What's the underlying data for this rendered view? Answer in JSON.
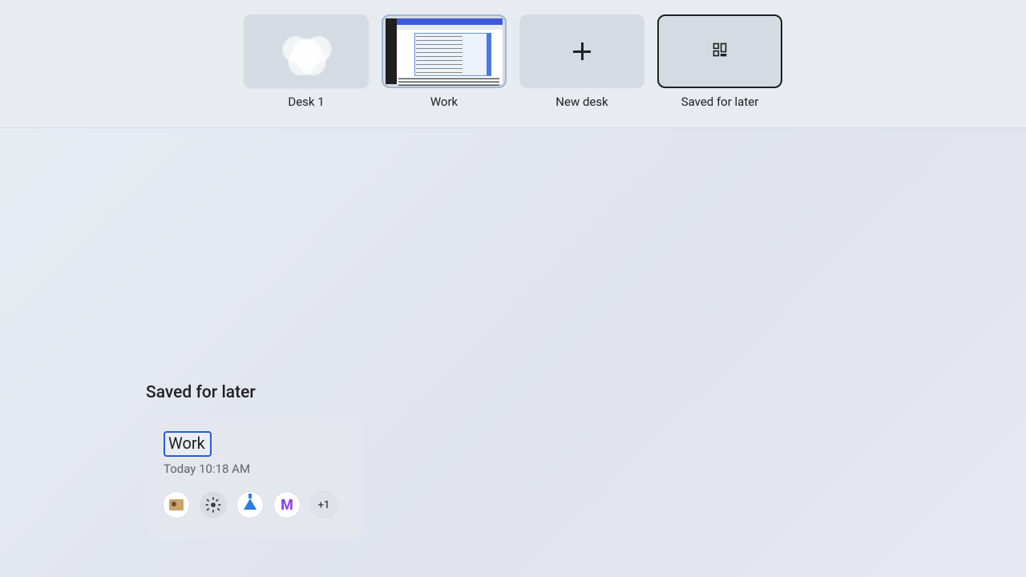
{
  "deskbar": {
    "desks": [
      {
        "label": "Desk 1"
      },
      {
        "label": "Work"
      },
      {
        "label": "New desk"
      },
      {
        "label": "Saved for later"
      }
    ]
  },
  "main": {
    "section_title": "Saved for later",
    "card": {
      "title": "Work",
      "timestamp": "Today 10:18 AM",
      "overflow_badge": "+1",
      "icons": [
        "photo",
        "settings",
        "flask",
        "mail"
      ]
    }
  }
}
